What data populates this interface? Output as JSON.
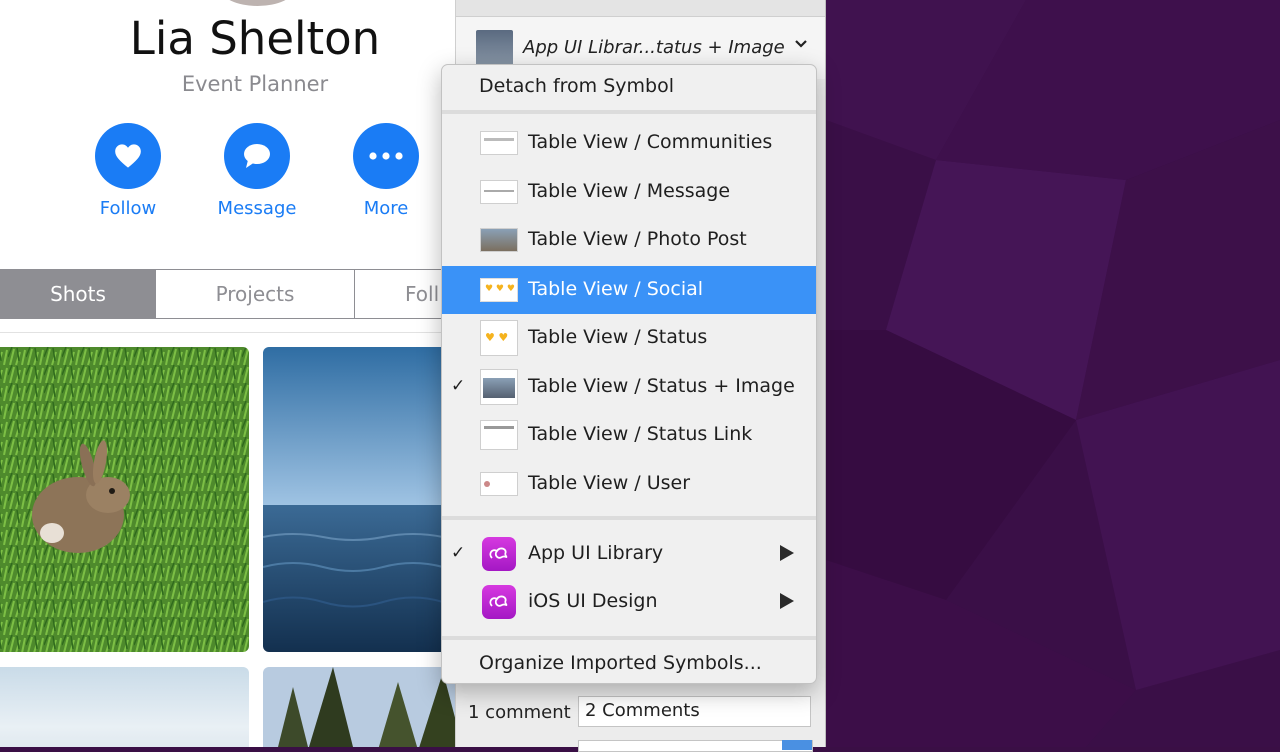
{
  "profile": {
    "name": "Lia Shelton",
    "role": "Event Planner",
    "actions": [
      {
        "label": "Follow",
        "icon": "heart-icon"
      },
      {
        "label": "Message",
        "icon": "chat-bubble-icon"
      },
      {
        "label": "More",
        "icon": "ellipsis-icon"
      }
    ],
    "tabs": [
      "Shots",
      "Projects",
      "Foll"
    ],
    "accent": "#1a7cf5"
  },
  "inspector": {
    "symbol_name": "App UI Librar...tatus + Image",
    "field_label": "1 comment",
    "field_value": "2 Comments"
  },
  "menu": {
    "detach_label": "Detach from Symbol",
    "items": [
      {
        "label": "Table View / Communities",
        "selected": false,
        "highlighted": false
      },
      {
        "label": "Table View / Message",
        "selected": false,
        "highlighted": false
      },
      {
        "label": "Table View / Photo Post",
        "selected": false,
        "highlighted": false
      },
      {
        "label": "Table View / Social",
        "selected": false,
        "highlighted": true
      },
      {
        "label": "Table View / Status",
        "selected": false,
        "highlighted": false
      },
      {
        "label": "Table View / Status + Image",
        "selected": true,
        "highlighted": false
      },
      {
        "label": "Table View / Status Link",
        "selected": false,
        "highlighted": false
      },
      {
        "label": "Table View / User",
        "selected": false,
        "highlighted": false
      }
    ],
    "libraries": [
      {
        "label": "App UI Library",
        "selected": true
      },
      {
        "label": "iOS UI Design",
        "selected": false
      }
    ],
    "organize_label": "Organize Imported Symbols...",
    "check_glyph": "✓",
    "highlight_color": "#3a92f7"
  }
}
